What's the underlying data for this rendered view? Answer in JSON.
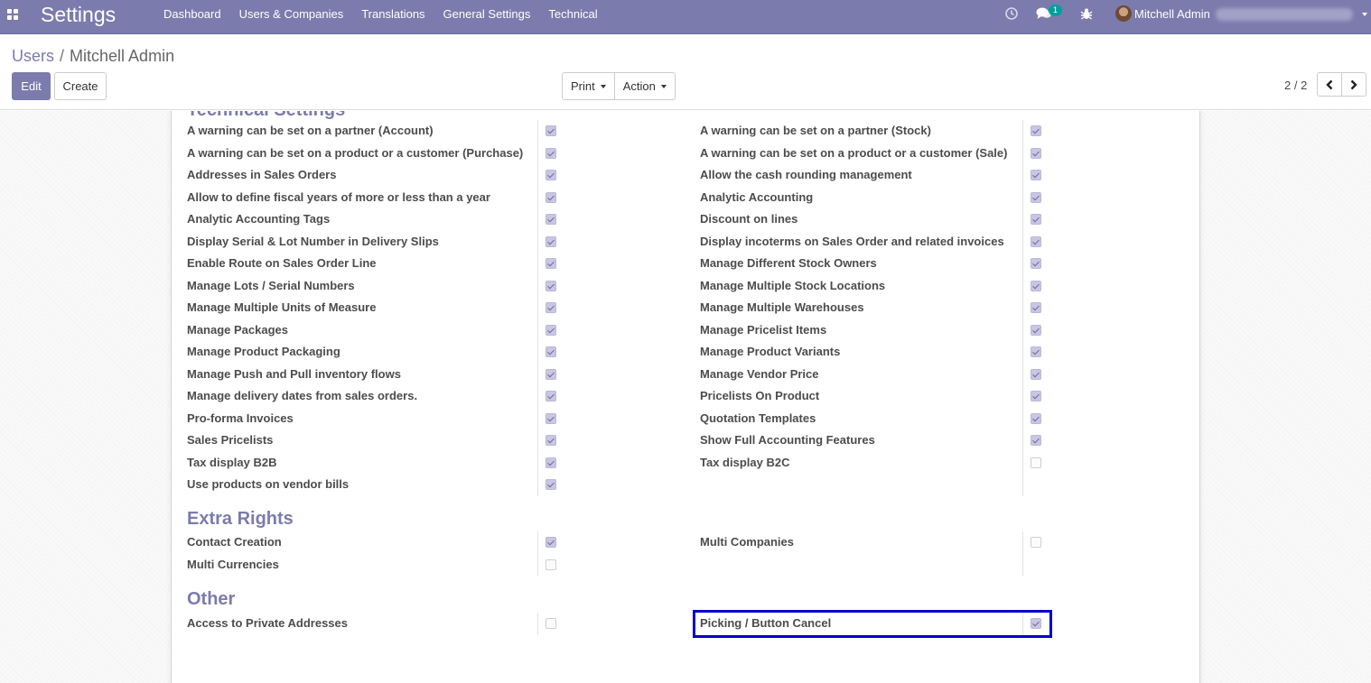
{
  "navbar": {
    "brand": "Settings",
    "menu": [
      "Dashboard",
      "Users & Companies",
      "Translations",
      "General Settings",
      "Technical"
    ],
    "chat_badge": "1",
    "user_name": "Mitchell Admin",
    "bg_color": "#7c7bad"
  },
  "control_panel": {
    "breadcrumb_parent": "Users",
    "breadcrumb_separator": "/",
    "breadcrumb_current": "Mitchell Admin",
    "edit_label": "Edit",
    "create_label": "Create",
    "print_label": "Print",
    "action_label": "Action",
    "pager": "2 / 2"
  },
  "sections": [
    {
      "title": "Technical Settings",
      "left": [
        {
          "label": "A warning can be set on a partner (Account)",
          "checked": true
        },
        {
          "label": "A warning can be set on a product or a customer (Purchase)",
          "checked": true
        },
        {
          "label": "Addresses in Sales Orders",
          "checked": true
        },
        {
          "label": "Allow to define fiscal years of more or less than a year",
          "checked": true
        },
        {
          "label": "Analytic Accounting Tags",
          "checked": true
        },
        {
          "label": "Display Serial & Lot Number in Delivery Slips",
          "checked": true
        },
        {
          "label": "Enable Route on Sales Order Line",
          "checked": true
        },
        {
          "label": "Manage Lots / Serial Numbers",
          "checked": true
        },
        {
          "label": "Manage Multiple Units of Measure",
          "checked": true
        },
        {
          "label": "Manage Packages",
          "checked": true
        },
        {
          "label": "Manage Product Packaging",
          "checked": true
        },
        {
          "label": "Manage Push and Pull inventory flows",
          "checked": true
        },
        {
          "label": "Manage delivery dates from sales orders.",
          "checked": true
        },
        {
          "label": "Pro-forma Invoices",
          "checked": true
        },
        {
          "label": "Sales Pricelists",
          "checked": true
        },
        {
          "label": "Tax display B2B",
          "checked": true
        },
        {
          "label": "Use products on vendor bills",
          "checked": true
        }
      ],
      "right": [
        {
          "label": "A warning can be set on a partner (Stock)",
          "checked": true
        },
        {
          "label": "A warning can be set on a product or a customer (Sale)",
          "checked": true
        },
        {
          "label": "Allow the cash rounding management",
          "checked": true
        },
        {
          "label": "Analytic Accounting",
          "checked": true
        },
        {
          "label": "Discount on lines",
          "checked": true
        },
        {
          "label": "Display incoterms on Sales Order and related invoices",
          "checked": true
        },
        {
          "label": "Manage Different Stock Owners",
          "checked": true
        },
        {
          "label": "Manage Multiple Stock Locations",
          "checked": true
        },
        {
          "label": "Manage Multiple Warehouses",
          "checked": true
        },
        {
          "label": "Manage Pricelist Items",
          "checked": true
        },
        {
          "label": "Manage Product Variants",
          "checked": true
        },
        {
          "label": "Manage Vendor Price",
          "checked": true
        },
        {
          "label": "Pricelists On Product",
          "checked": true
        },
        {
          "label": "Quotation Templates",
          "checked": true
        },
        {
          "label": "Show Full Accounting Features",
          "checked": true
        },
        {
          "label": "Tax display B2C",
          "checked": false
        }
      ]
    },
    {
      "title": "Extra Rights",
      "left": [
        {
          "label": "Contact Creation",
          "checked": true
        },
        {
          "label": "Multi Currencies",
          "checked": false
        }
      ],
      "right": [
        {
          "label": "Multi Companies",
          "checked": false
        }
      ]
    },
    {
      "title": "Other",
      "left": [
        {
          "label": "Access to Private Addresses",
          "checked": false
        }
      ],
      "right": [
        {
          "label": "Picking / Button Cancel",
          "checked": true,
          "highlighted": true
        }
      ]
    }
  ]
}
